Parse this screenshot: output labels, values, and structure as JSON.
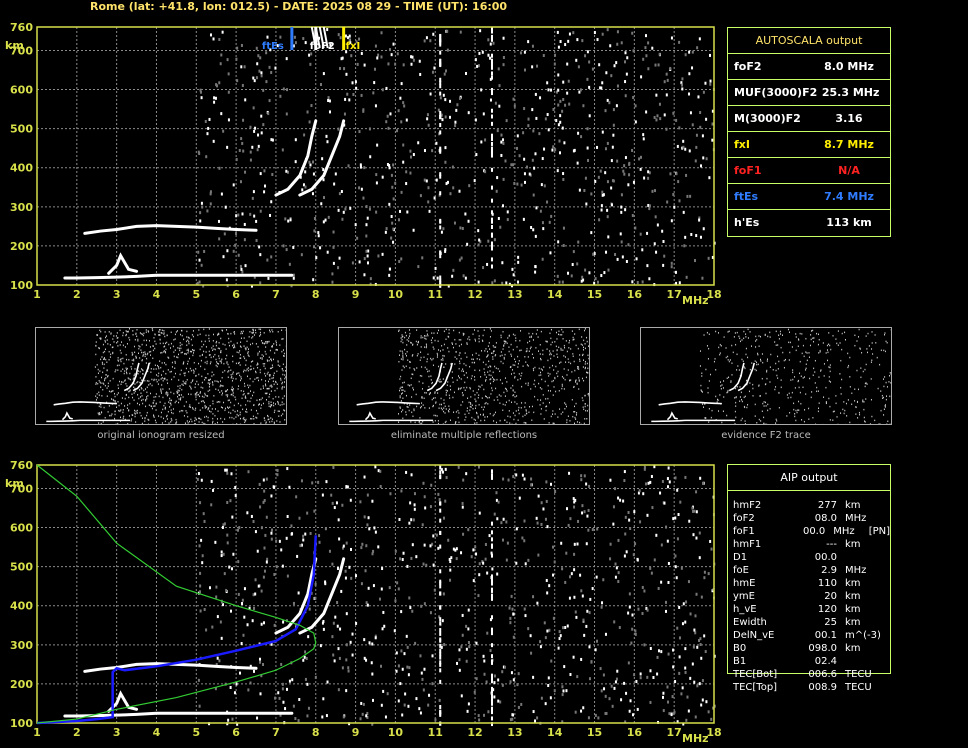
{
  "header": "Rome (lat: +41.8, lon: 012.5) - DATE: 2025 08 29 - TIME (UT): 16:00",
  "colors": {
    "frame": "#d8e04a",
    "grid": "#8a8a8a",
    "trace": "#ffffff",
    "ftEs": "#2f7cff",
    "foF2": "#ffffff",
    "fxI": "#ffee00",
    "profile": "#1a1aff",
    "model": "#33cc33",
    "panel_border": "#c9ff66"
  },
  "autoscala": {
    "title": "AUTOSCALA output",
    "rows": [
      {
        "label": "foF2",
        "value": "8.0 MHz",
        "color": "#ffffff"
      },
      {
        "label": "MUF(3000)F2",
        "value": "25.3 MHz",
        "color": "#ffffff"
      },
      {
        "label": "M(3000)F2",
        "value": "3.16",
        "color": "#ffffff"
      },
      {
        "label": "fxI",
        "value": "8.7 MHz",
        "color": "#ffee00"
      },
      {
        "label": "foF1",
        "value": "N/A",
        "color": "#ff2222"
      },
      {
        "label": "ftEs",
        "value": "7.4 MHz",
        "color": "#2f7cff"
      },
      {
        "label": "h'Es",
        "value": "113    km",
        "color": "#ffffff"
      }
    ]
  },
  "aip": {
    "title": "AIP output",
    "rows": [
      [
        "hmF2",
        "277",
        "km",
        ""
      ],
      [
        "foF2",
        "08.0",
        "MHz",
        ""
      ],
      [
        "foF1",
        "00.0",
        "MHz",
        "[PN]"
      ],
      [
        "hmF1",
        "---",
        "km",
        ""
      ],
      [
        "D1",
        "00.0",
        "",
        ""
      ],
      [
        "foE",
        "2.9",
        "MHz",
        ""
      ],
      [
        "hmE",
        "110",
        "km",
        ""
      ],
      [
        "ymE",
        "20",
        "km",
        ""
      ],
      [
        "h_vE",
        "120",
        "km",
        ""
      ],
      [
        "Ewidth",
        "25",
        "km",
        ""
      ],
      [
        "DelN_vE",
        "00.1",
        "m^(-3)",
        ""
      ],
      [
        "B0",
        "098.0",
        "km",
        ""
      ],
      [
        "B1",
        "02.4",
        "",
        ""
      ],
      [
        "TEC[Bot]",
        "006.6",
        "TECU",
        ""
      ],
      [
        "TEC[Top]",
        "008.9",
        "TECU",
        ""
      ]
    ]
  },
  "thumb_captions": [
    "original ionogram resized",
    "eliminate multiple reflections",
    "evidence F2 trace"
  ],
  "markers": {
    "ftEs": "ftEs",
    "foF2": "foF2",
    "fxI": "fxI"
  },
  "chart_data": [
    {
      "type": "scatter",
      "title": "",
      "xlabel": "MHz",
      "ylabel": "km",
      "xlim": [
        1,
        18
      ],
      "ylim": [
        100,
        760
      ],
      "xticks": [
        1,
        2,
        3,
        4,
        5,
        6,
        7,
        8,
        9,
        10,
        11,
        12,
        13,
        14,
        15,
        16,
        17,
        18
      ],
      "yticks": [
        100,
        200,
        300,
        400,
        500,
        600,
        700,
        760
      ],
      "grid": true,
      "vertical_markers": [
        {
          "name": "ftEs",
          "x": 7.4
        },
        {
          "name": "foF2",
          "x": 8.0
        },
        {
          "name": "fxI",
          "x": 8.7
        }
      ],
      "series": [
        {
          "x": [
            1.7,
            2.0,
            2.5,
            3.0,
            3.5,
            4.0,
            5.0,
            6.0,
            7.0,
            7.4
          ],
          "y": [
            118,
            118,
            119,
            120,
            122,
            125,
            125,
            125,
            125,
            125
          ]
        },
        {
          "x": [
            2.8,
            3.0,
            3.1,
            3.3,
            3.5
          ],
          "y": [
            130,
            150,
            175,
            140,
            135
          ]
        },
        {
          "x": [
            2.2,
            2.6,
            3.0,
            3.5,
            4.0,
            4.5,
            5.0,
            5.5,
            6.0,
            6.5
          ],
          "y": [
            232,
            238,
            242,
            250,
            252,
            250,
            248,
            245,
            242,
            240
          ]
        },
        {
          "x": [
            7.0,
            7.3,
            7.6,
            7.8,
            7.9,
            8.0
          ],
          "y": [
            330,
            345,
            380,
            430,
            480,
            520
          ]
        },
        {
          "x": [
            7.6,
            7.9,
            8.2,
            8.4,
            8.6,
            8.7
          ],
          "y": [
            330,
            345,
            380,
            430,
            480,
            520
          ]
        }
      ]
    },
    {
      "type": "line",
      "title": "",
      "xlabel": "MHz",
      "ylabel": "km",
      "xlim": [
        1,
        18
      ],
      "ylim": [
        100,
        760
      ],
      "xticks": [
        1,
        2,
        3,
        4,
        5,
        6,
        7,
        8,
        9,
        10,
        11,
        12,
        13,
        14,
        15,
        16,
        17,
        18
      ],
      "yticks": [
        100,
        200,
        300,
        400,
        500,
        600,
        700,
        760
      ],
      "grid": true,
      "series": [
        {
          "name": "profile",
          "x": [
            1.0,
            2.0,
            2.5,
            2.9,
            2.9,
            3.0,
            3.2,
            4.0,
            5.0,
            6.0,
            7.0,
            7.5,
            7.8,
            7.95,
            8.0
          ],
          "y": [
            100,
            105,
            110,
            115,
            230,
            240,
            235,
            245,
            262,
            285,
            310,
            340,
            400,
            480,
            580
          ]
        },
        {
          "name": "model",
          "x": [
            1.0,
            2.0,
            3.0,
            4.5,
            6.0,
            7.0,
            7.6,
            7.95,
            8.0,
            7.95,
            7.6,
            7.0,
            6.0,
            4.5,
            3.0,
            2.0,
            1.0
          ],
          "y": [
            100,
            110,
            135,
            165,
            205,
            235,
            265,
            290,
            305,
            330,
            350,
            370,
            400,
            450,
            560,
            680,
            760
          ]
        }
      ]
    }
  ]
}
